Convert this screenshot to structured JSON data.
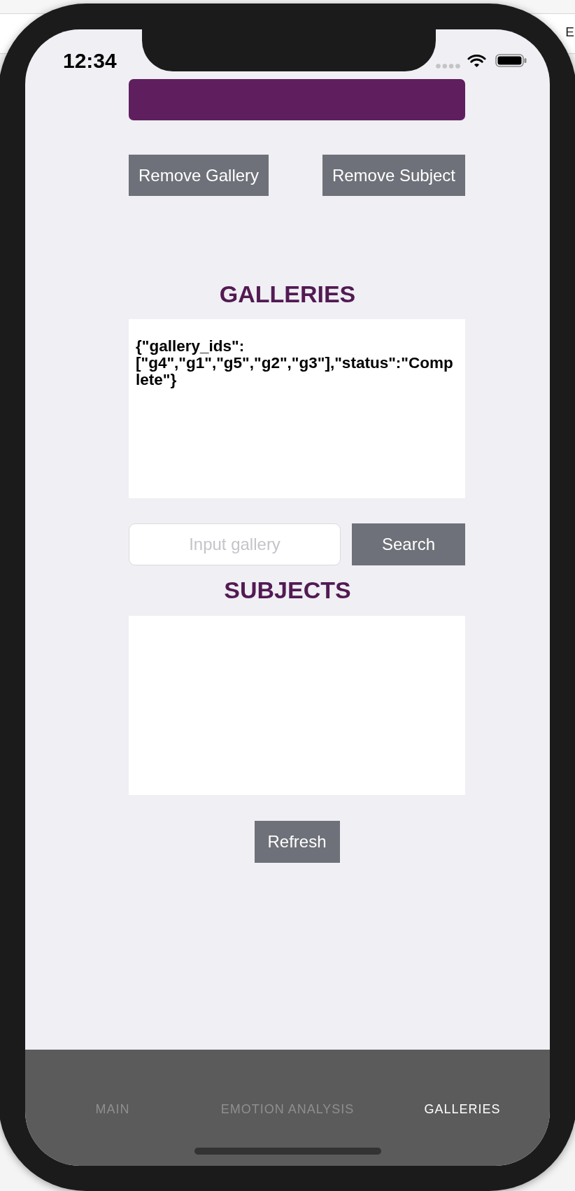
{
  "backdrop": {
    "edge_text": "E"
  },
  "status_bar": {
    "time": "12:34"
  },
  "actions": [
    {
      "label": "Remove Gallery"
    },
    {
      "label": "Remove Subject"
    }
  ],
  "galleries": {
    "heading": "GALLERIES",
    "output": "{\"gallery_ids\":[\"g4\",\"g1\",\"g5\",\"g2\",\"g3\"],\"status\":\"Complete\"}"
  },
  "search": {
    "placeholder": "Input gallery",
    "button": "Search"
  },
  "subjects": {
    "heading": "SUBJECTS",
    "refresh_button": "Refresh"
  },
  "tabs": [
    {
      "label": "MAIN",
      "selected": false
    },
    {
      "label": "EMOTION ANALYSIS",
      "selected": false
    },
    {
      "label": "GALLERIES",
      "selected": true
    }
  ]
}
